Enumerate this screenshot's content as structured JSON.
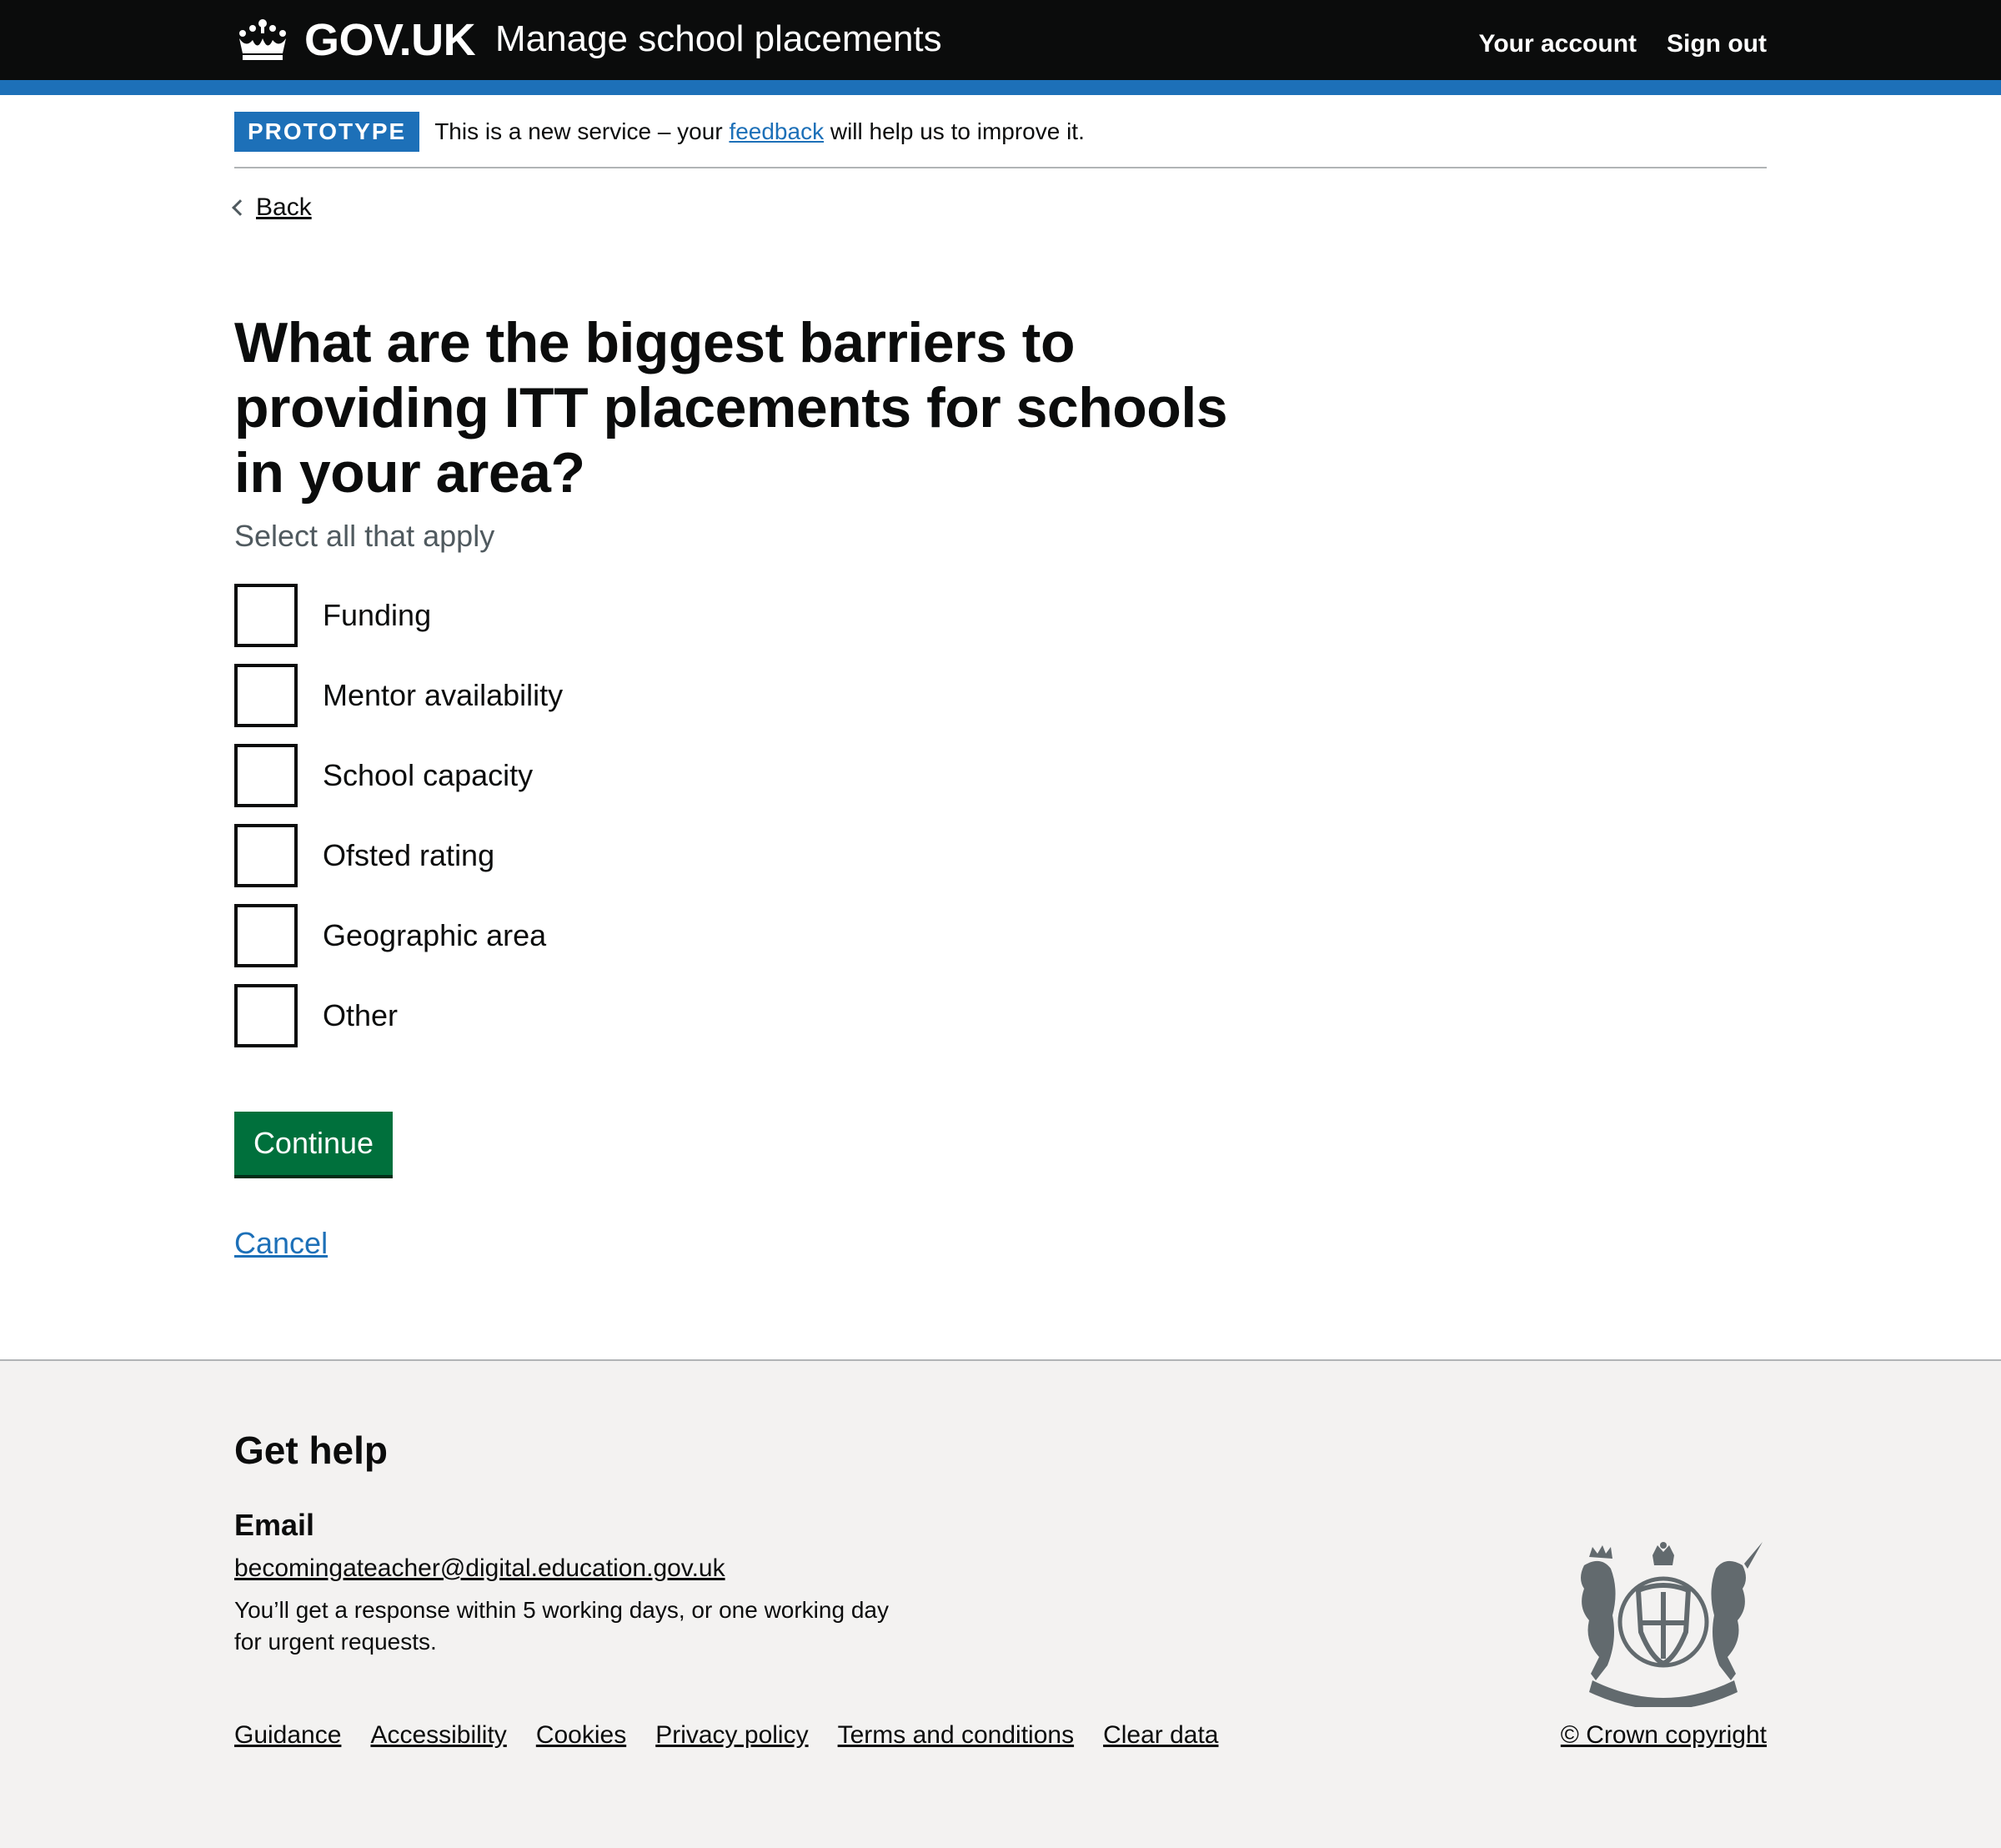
{
  "header": {
    "logo_text": "GOV.UK",
    "service_name": "Manage school placements",
    "nav": [
      {
        "label": "Your account"
      },
      {
        "label": "Sign out"
      }
    ]
  },
  "phase_banner": {
    "tag": "PROTOTYPE",
    "text_before": "This is a new service – your ",
    "link": "feedback",
    "text_after": " will help us to improve it."
  },
  "back_link": "Back",
  "question": {
    "heading": "What are the biggest barriers to providing ITT placements for schools in your area?",
    "hint": "Select all that apply",
    "options": [
      {
        "label": "Funding",
        "checked": false
      },
      {
        "label": "Mentor availability",
        "checked": false
      },
      {
        "label": "School capacity",
        "checked": false
      },
      {
        "label": "Ofsted rating",
        "checked": false
      },
      {
        "label": "Geographic area",
        "checked": false
      },
      {
        "label": "Other",
        "checked": false
      }
    ]
  },
  "actions": {
    "continue": "Continue",
    "cancel": "Cancel"
  },
  "footer": {
    "title": "Get help",
    "email_heading": "Email",
    "email": "becomingateacher@digital.education.gov.uk",
    "response": "You’ll get a response within 5 working days, or one working day for urgent requests.",
    "links": [
      "Guidance",
      "Accessibility",
      "Cookies",
      "Privacy policy",
      "Terms and conditions",
      "Clear data"
    ],
    "copyright": "© Crown copyright"
  },
  "colors": {
    "header_bg": "#0b0c0c",
    "brand_blue": "#1d70b8",
    "button_green": "#00703c",
    "footer_bg": "#f3f2f1",
    "hint_grey": "#505a5f"
  }
}
